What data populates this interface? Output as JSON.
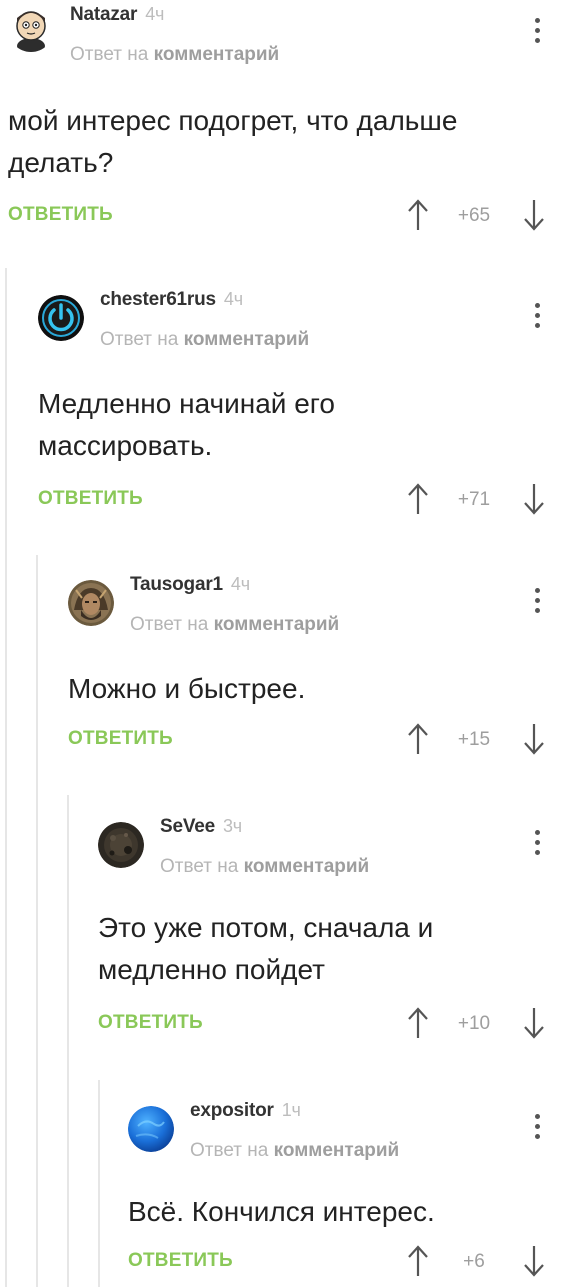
{
  "labels": {
    "reply_prefix": "Ответ на",
    "reply_target": "комментарий",
    "reply_button": "ОТВЕТИТЬ"
  },
  "colors": {
    "accent_green": "#8ac858",
    "muted_text": "#b5b5b5",
    "thread_line": "#e6e6e6"
  },
  "comments": [
    {
      "username": "Natazar",
      "time": "4ч",
      "text_lines": [
        "мой интерес подогрет, что дальше",
        "делать?"
      ],
      "score": "+65",
      "avatar_icon": "cartoon-avatar-icon"
    },
    {
      "username": "chester61rus",
      "time": "4ч",
      "text_lines": [
        "Медленно начинай его",
        "массировать."
      ],
      "score": "+71",
      "avatar_icon": "power-button-avatar-icon"
    },
    {
      "username": "Tausogar1",
      "time": "4ч",
      "text_lines": [
        "Можно и быстрее."
      ],
      "score": "+15",
      "avatar_icon": "warrior-avatar-icon"
    },
    {
      "username": "SeVee",
      "time": "3ч",
      "text_lines": [
        "Это уже потом, сначала и",
        "медленно пойдет"
      ],
      "score": "+10",
      "avatar_icon": "dark-texture-avatar-icon"
    },
    {
      "username": "expositor",
      "time": "1ч",
      "text_lines": [
        "Всё. Кончился интерес."
      ],
      "score": "+6",
      "avatar_icon": "blue-globe-avatar-icon"
    }
  ]
}
